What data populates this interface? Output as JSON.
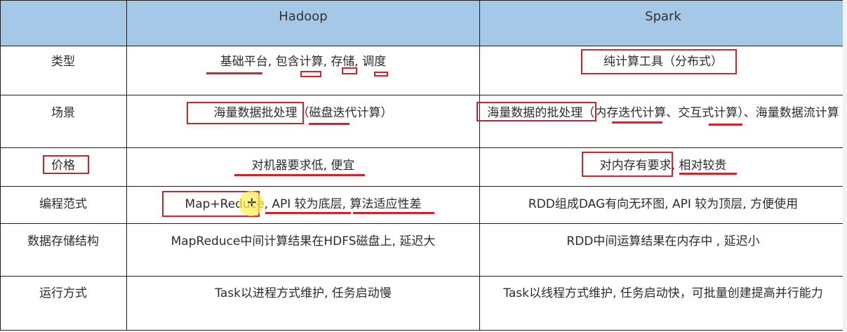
{
  "table": {
    "headers": [
      "",
      "Hadoop",
      "Spark"
    ],
    "rows": [
      {
        "label": "类型",
        "hadoop": "基础平台, 包含计算, 存储, 调度",
        "spark": "纯计算工具（分布式）"
      },
      {
        "label": "场景",
        "hadoop": "海量数据批处理（磁盘迭代计算）",
        "spark": "海量数据的批处理（内存迭代计算、交互式计算）、海量数据流计算"
      },
      {
        "label": "价格",
        "hadoop": "对机器要求低, 便宜",
        "spark": "对内存有要求, 相对较贵"
      },
      {
        "label": "编程范式",
        "hadoop": "Map+Reduce, API 较为底层, 算法适应性差",
        "spark": "RDD组成DAG有向无环图, API 较为顶层, 方便使用"
      },
      {
        "label": "数据存储结构",
        "hadoop": "MapReduce中间计算结果在HDFS磁盘上, 延迟大",
        "spark": "RDD中间运算结果在内存中 , 延迟小"
      },
      {
        "label": "运行方式",
        "hadoop": "Task以进程方式维护, 任务启动慢",
        "spark": "Task以线程方式维护, 任务启动快，可批量创建提高并行能力"
      }
    ]
  },
  "colors": {
    "header_bg": "#a6c8e8",
    "annotation": "#d8202a",
    "cursor_highlight": "#fff05a"
  },
  "cursor": {
    "icon": "crosshair-cursor-icon"
  }
}
